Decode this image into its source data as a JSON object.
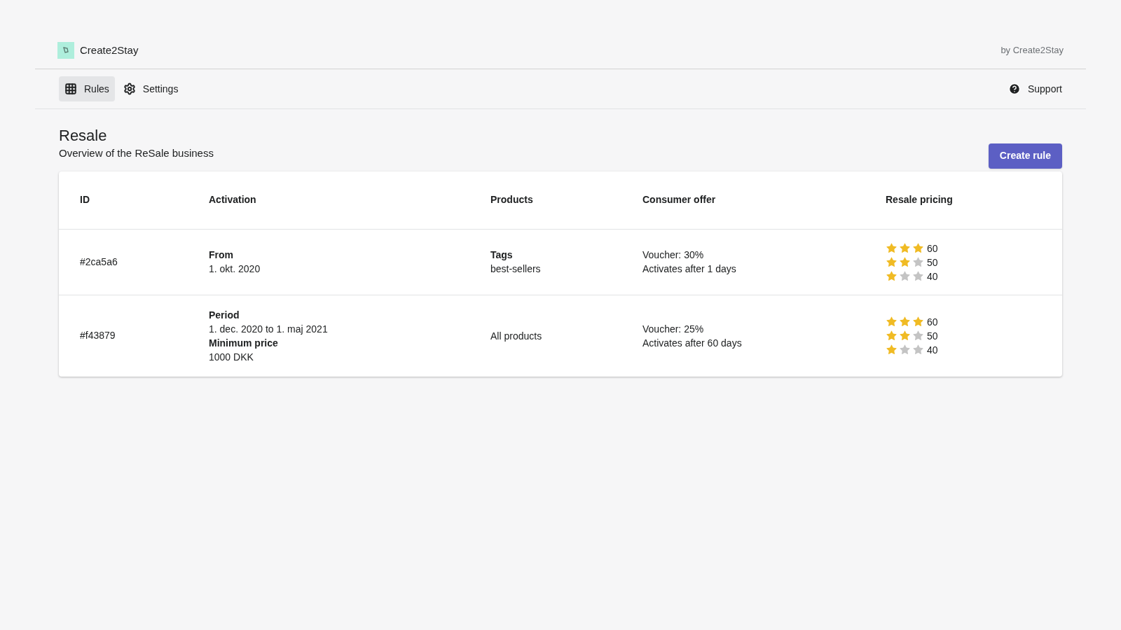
{
  "brand": {
    "name": "Create2Stay",
    "byline": "by Create2Stay"
  },
  "nav": [
    {
      "label": "Rules",
      "selected": true,
      "kind": "grid"
    },
    {
      "label": "Settings",
      "selected": false,
      "kind": "gear"
    }
  ],
  "support": "Support",
  "page": {
    "title": "Resale",
    "subtitle": "Overview of the ReSale business",
    "button": "Create rule"
  },
  "table": {
    "columns": [
      "ID",
      "Activation",
      "Products",
      "Consumer offer",
      "Resale pricing"
    ],
    "rows": [
      {
        "id": "#2ca5a6",
        "activation": [
          {
            "kind": "label",
            "text": "From"
          },
          {
            "kind": "value",
            "text": "1. okt. 2020"
          }
        ],
        "products": [
          {
            "kind": "label",
            "text": "Tags"
          },
          {
            "kind": "value",
            "text": "best-sellers"
          }
        ],
        "offer": [
          "Voucher: 30%",
          "Activates after 1 days"
        ],
        "pricing": [
          {
            "stars": 3,
            "value": "60"
          },
          {
            "stars": 2,
            "value": "50"
          },
          {
            "stars": 1,
            "value": "40"
          }
        ]
      },
      {
        "id": "#f43879",
        "activation": [
          {
            "kind": "label",
            "text": "Period"
          },
          {
            "kind": "value",
            "text": "1. dec. 2020 to 1. maj 2021"
          },
          {
            "kind": "label",
            "text": "Minimum price"
          },
          {
            "kind": "value",
            "text": "1000 DKK"
          }
        ],
        "products": [
          {
            "kind": "value",
            "text": "All products"
          }
        ],
        "offer": [
          "Voucher: 25%",
          "Activates after 60 days"
        ],
        "pricing": [
          {
            "stars": 3,
            "value": "60"
          },
          {
            "stars": 2,
            "value": "50"
          },
          {
            "stars": 1,
            "value": "40"
          }
        ]
      }
    ]
  }
}
